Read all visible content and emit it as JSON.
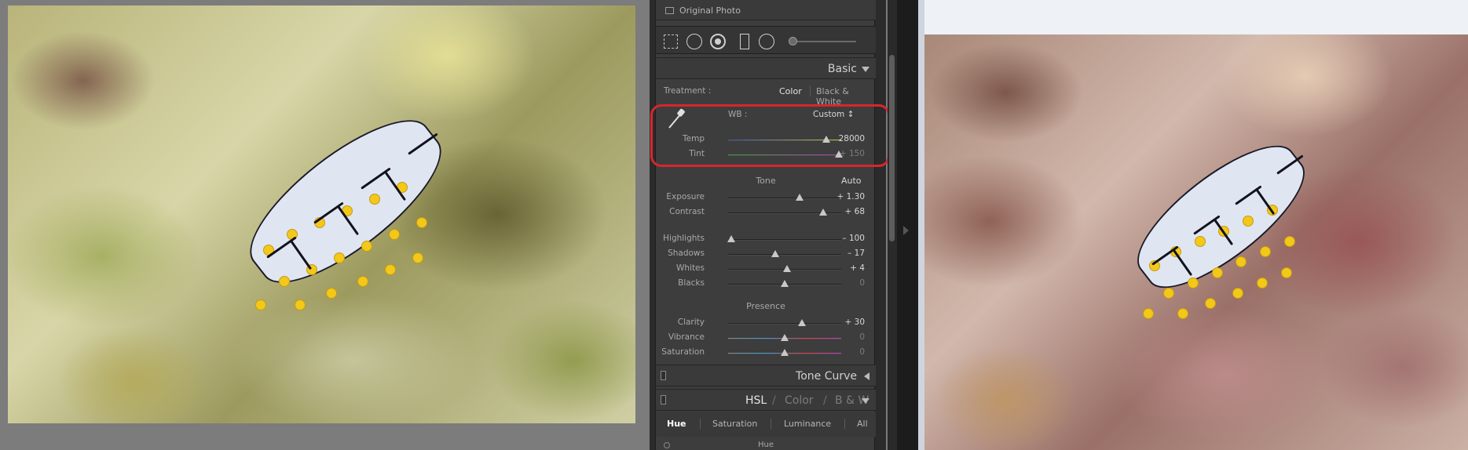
{
  "panel": {
    "original_photo_label": "Original Photo",
    "tools": [
      {
        "name": "crop-overlay-icon"
      },
      {
        "name": "spot-removal-icon"
      },
      {
        "name": "red-eye-icon"
      },
      {
        "name": "graduated-filter-icon"
      },
      {
        "name": "radial-filter-icon"
      },
      {
        "name": "adjustment-brush-icon"
      }
    ],
    "basic": {
      "title": "Basic",
      "treatment_label": "Treatment :",
      "treatment_color": "Color",
      "treatment_bw": "Black & White",
      "wb_label": "WB :",
      "wb_value": "Custom ↕",
      "temp": {
        "label": "Temp",
        "value": "28000",
        "level": 0.87
      },
      "tint": {
        "label": "Tint",
        "value": "+ 150",
        "level": 0.98
      },
      "tone_label": "Tone",
      "auto_label": "Auto",
      "tone": [
        {
          "label": "Exposure",
          "value": "+ 1.30",
          "level": 0.63
        },
        {
          "label": "Contrast",
          "value": "+ 68",
          "level": 0.84
        }
      ],
      "tone2": [
        {
          "label": "Highlights",
          "value": "– 100",
          "level": 0.03
        },
        {
          "label": "Shadows",
          "value": "– 17",
          "level": 0.42
        },
        {
          "label": "Whites",
          "value": "+ 4",
          "level": 0.52
        },
        {
          "label": "Blacks",
          "value": "0",
          "level": 0.5
        }
      ],
      "presence_label": "Presence",
      "presence": [
        {
          "label": "Clarity",
          "value": "+ 30",
          "level": 0.65
        },
        {
          "label": "Vibrance",
          "value": "0",
          "level": 0.5
        },
        {
          "label": "Saturation",
          "value": "0",
          "level": 0.5
        }
      ]
    },
    "tone_curve_title": "Tone Curve",
    "hsl_header": {
      "hsl": "HSL",
      "sep1": "/",
      "color": "Color",
      "sep2": "/",
      "bw": "B & W"
    },
    "hsl_tabs": [
      "Hue",
      "Saturation",
      "Luminance",
      "All"
    ],
    "hsl_sub": "Hue"
  },
  "colors": {
    "highlight_box": "#d7262e",
    "panel_bg": "#3d3d3d"
  }
}
